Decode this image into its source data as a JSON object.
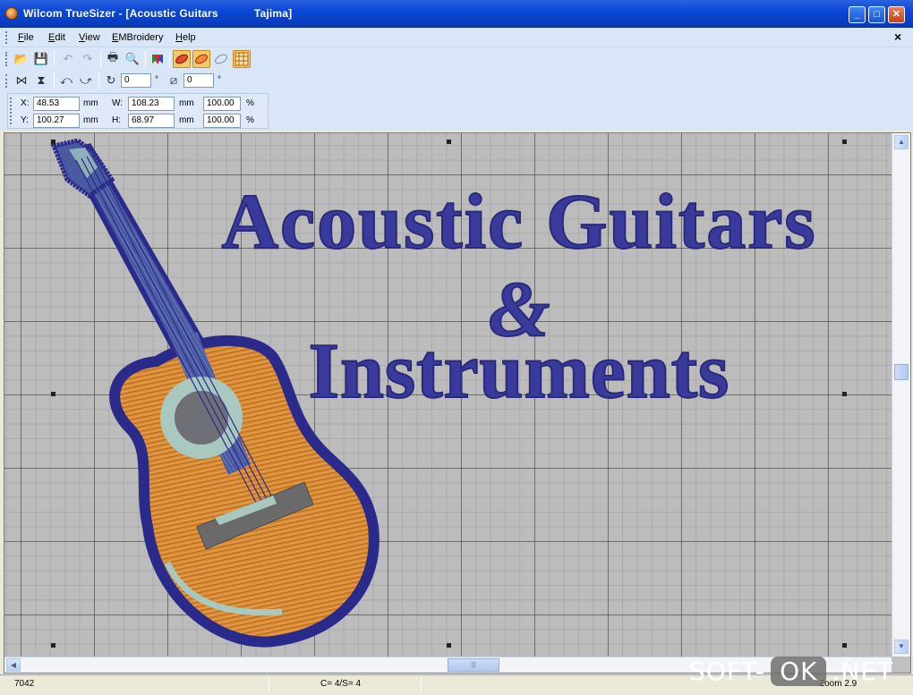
{
  "window": {
    "app_name": "Wilcom TrueSizer - [Acoustic Guitars",
    "title_suffix": "Tajima]",
    "minimize_symbol": "_",
    "maximize_symbol": "□",
    "close_symbol": "✕"
  },
  "menu": {
    "items": [
      "File",
      "Edit",
      "View",
      "EMBroidery",
      "Help"
    ],
    "mdi_close": "×"
  },
  "toolbar_main": {
    "icons": [
      "open-icon",
      "save-icon",
      "undo-icon",
      "redo-icon",
      "print-icon",
      "print-preview-icon",
      "color-icon",
      "show-stitches-icon",
      "show-outlines-icon",
      "artwork-icon",
      "grid-icon"
    ]
  },
  "toolbar_transform": {
    "rotate_value": "0",
    "rotate_unit": "°",
    "slant_value": "0",
    "slant_unit": "°"
  },
  "coords": {
    "x_label": "X:",
    "x_value": "48.53",
    "x_unit": "mm",
    "y_label": "Y:",
    "y_value": "100.27",
    "y_unit": "mm",
    "w_label": "W:",
    "w_value": "108.23",
    "w_unit": "mm",
    "h_label": "H:",
    "h_value": "68.97",
    "h_unit": "mm",
    "w_scale": "100.00",
    "h_scale": "100.00",
    "pct": "%"
  },
  "design": {
    "line1": "Acoustic Guitars",
    "line2": "&",
    "line3": "Instruments",
    "text_color": "#3a3a9c",
    "guitar_body_color": "#d98c36",
    "guitar_outline_color": "#2a2a8a",
    "soundhole_ring_color": "#a8c8c0"
  },
  "status": {
    "stitches": "7042",
    "colors": "C= 4/S= 4",
    "zoom": "Zoom 2.9"
  },
  "watermark": {
    "left": "SOFT-",
    "middle": "OK",
    "right": ".NET"
  }
}
